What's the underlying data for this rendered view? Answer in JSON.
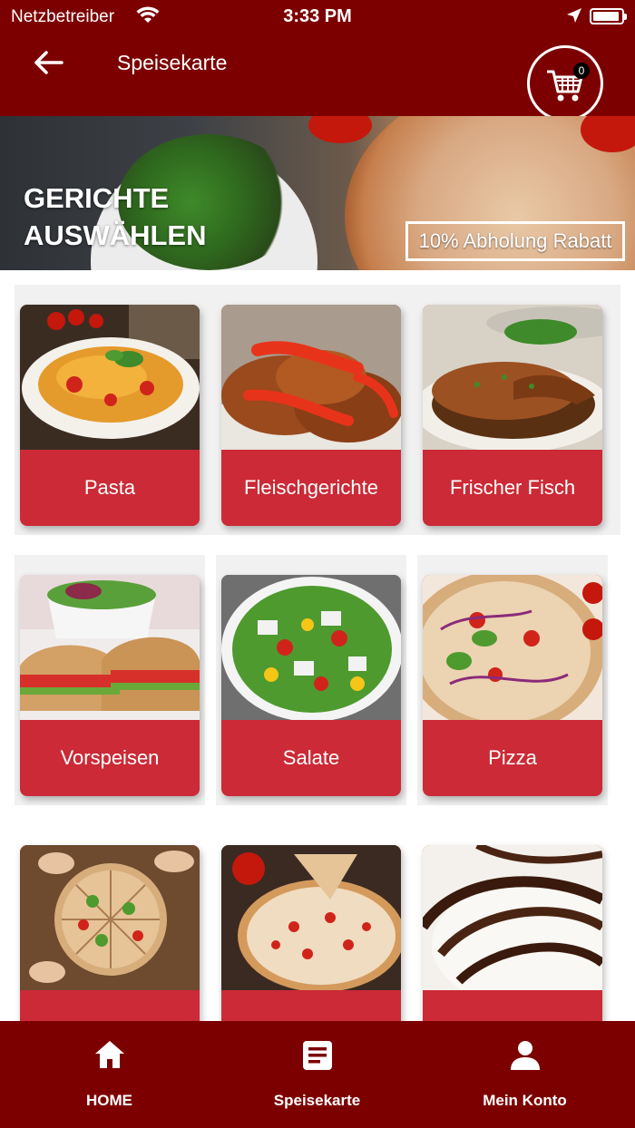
{
  "status_bar": {
    "carrier": "Netzbetreiber",
    "time": "3:33 PM"
  },
  "header": {
    "title": "Speisekarte",
    "cart_count": "0"
  },
  "hero": {
    "title": "GERICHTE\nAUSWÄHLEN",
    "discount": "10% Abholung Rabatt"
  },
  "categories": [
    {
      "label": "Pasta"
    },
    {
      "label": "Fleischgerichte"
    },
    {
      "label": "Frischer Fisch"
    },
    {
      "label": "Vorspeisen"
    },
    {
      "label": "Salate"
    },
    {
      "label": "Pizza"
    },
    {
      "label": ""
    },
    {
      "label": ""
    },
    {
      "label": ""
    }
  ],
  "bottom_nav": [
    {
      "label": "HOME",
      "icon": "home-icon"
    },
    {
      "label": "Speisekarte",
      "icon": "menu-list-icon"
    },
    {
      "label": "Mein Konto",
      "icon": "account-icon"
    }
  ],
  "colors": {
    "bar": "#7d0001",
    "card_label_bg": "#cb2a36"
  }
}
